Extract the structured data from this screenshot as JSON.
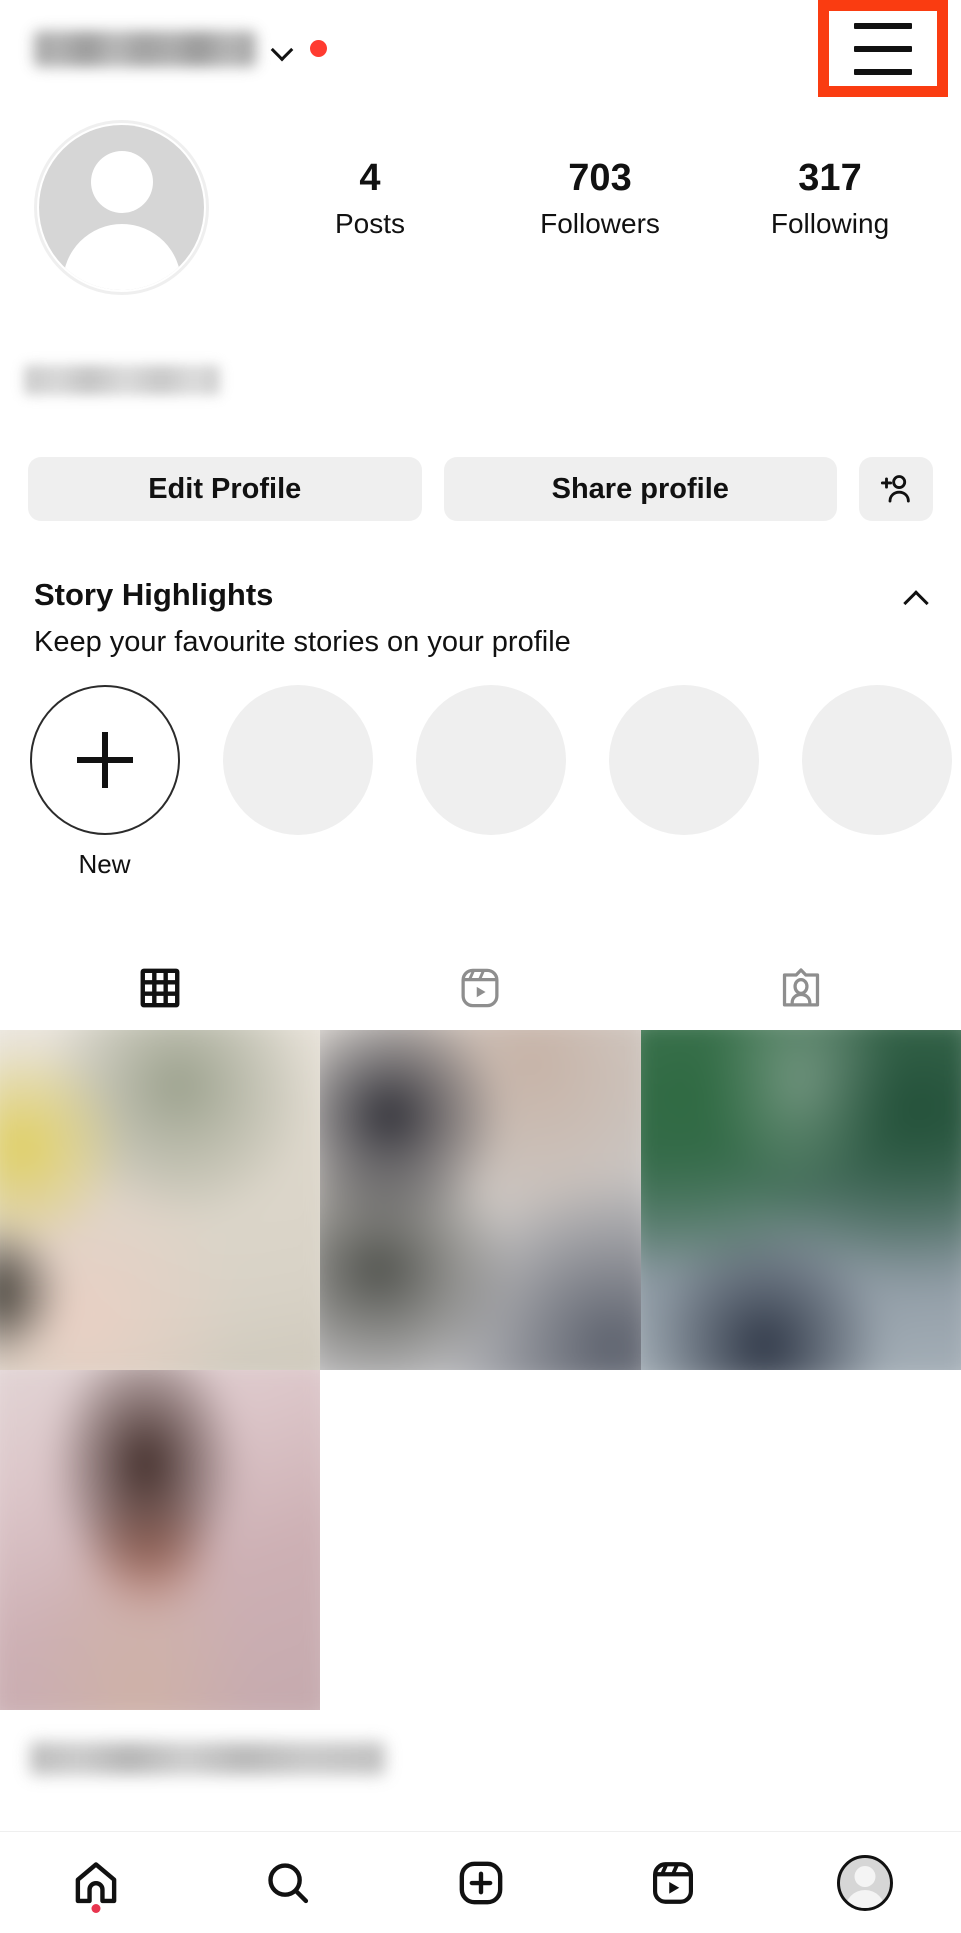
{
  "theme": {
    "accent_red": "#FF3B30",
    "highlight_box": "#FA3C11",
    "text": "#111111",
    "pill_bg": "#EFEFEF",
    "nav_badge": "#E8344E"
  },
  "header": {
    "username": "",
    "username_redacted": true,
    "chevron_icon": "chevron-down-icon",
    "notification_dot": true,
    "create_icon": "plus-square-icon",
    "menu_icon": "hamburger-menu-icon",
    "menu_highlighted": true
  },
  "profile": {
    "avatar_icon": "default-avatar-icon",
    "display_name": "",
    "display_name_redacted": true,
    "stats": [
      {
        "value": "4",
        "label": "Posts"
      },
      {
        "value": "703",
        "label": "Followers"
      },
      {
        "value": "317",
        "label": "Following"
      }
    ]
  },
  "actions": {
    "edit_profile_label": "Edit Profile",
    "share_profile_label": "Share profile",
    "add_person_icon": "add-person-icon"
  },
  "highlights": {
    "title": "Story Highlights",
    "subtitle": "Keep your favourite stories on your profile",
    "collapse_icon": "chevron-up-icon",
    "new_label": "New",
    "new_icon": "plus-icon",
    "placeholder_count": 4
  },
  "content_tabs": [
    {
      "name": "grid",
      "icon": "grid-icon",
      "active": true
    },
    {
      "name": "reels",
      "icon": "reels-icon",
      "active": false
    },
    {
      "name": "tagged",
      "icon": "tagged-icon",
      "active": false
    }
  ],
  "grid": {
    "posts": [
      {
        "id": "post-1",
        "class": "ph-1",
        "blurred": true
      },
      {
        "id": "post-2",
        "class": "ph-2",
        "blurred": true
      },
      {
        "id": "post-3",
        "class": "ph-3",
        "blurred": true
      },
      {
        "id": "post-4",
        "class": "ph-4",
        "blurred": true
      }
    ],
    "caption_redacted": true
  },
  "bottom_nav": [
    {
      "name": "home",
      "icon": "home-icon",
      "badge": true,
      "active": false
    },
    {
      "name": "search",
      "icon": "search-icon",
      "badge": false,
      "active": false
    },
    {
      "name": "create",
      "icon": "plus-square-icon",
      "badge": false,
      "active": false
    },
    {
      "name": "reels",
      "icon": "reels-icon",
      "badge": false,
      "active": false
    },
    {
      "name": "profile",
      "icon": "profile-avatar-icon",
      "badge": false,
      "active": true
    }
  ]
}
